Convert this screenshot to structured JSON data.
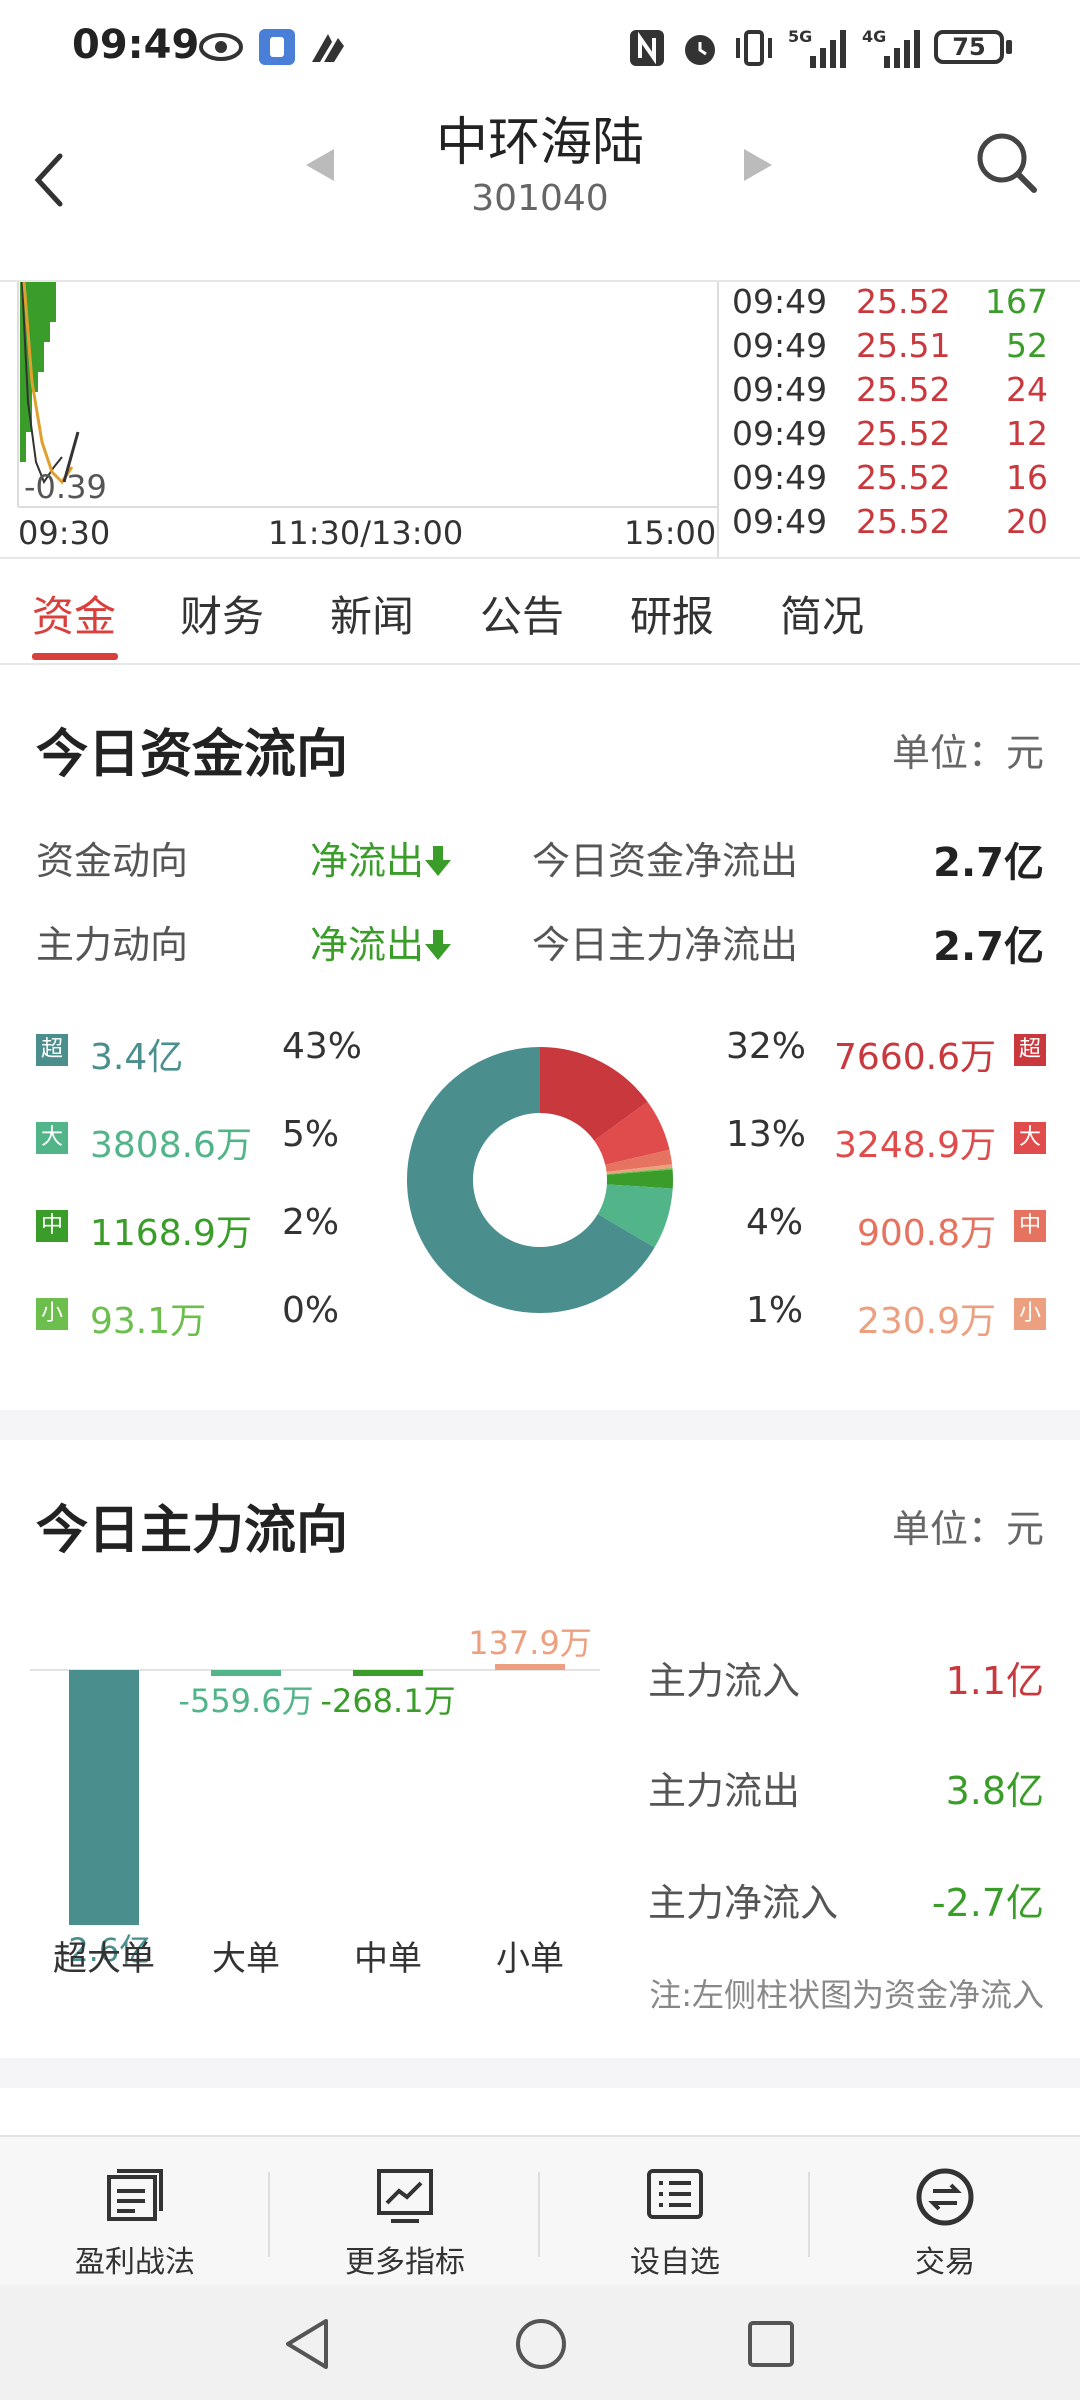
{
  "status_bar": {
    "time": "09:49",
    "battery": "75",
    "icons": [
      "eye-icon",
      "notification-app-icon",
      "app-logo-icon",
      "nfc-icon",
      "alarm-icon",
      "vibrate-icon",
      "signal-5g-icon",
      "signal-4g-icon",
      "battery-icon"
    ]
  },
  "header": {
    "title": "中环海陆",
    "code": "301040"
  },
  "minichart": {
    "low_value": "-0.39",
    "time_labels": [
      "09:30",
      "11:30/13:00",
      "15:00"
    ],
    "trades": [
      {
        "time": "09:49",
        "price": "25.52",
        "vol": "167"
      },
      {
        "time": "09:49",
        "price": "25.51",
        "vol": "52"
      },
      {
        "time": "09:49",
        "price": "25.52",
        "vol": "24"
      },
      {
        "time": "09:49",
        "price": "25.52",
        "vol": "12"
      },
      {
        "time": "09:49",
        "price": "25.52",
        "vol": "16"
      },
      {
        "time": "09:49",
        "price": "25.52",
        "vol": "20"
      }
    ]
  },
  "tabs": [
    {
      "label": "资金",
      "active": true
    },
    {
      "label": "财务"
    },
    {
      "label": "新闻"
    },
    {
      "label": "公告"
    },
    {
      "label": "研报"
    },
    {
      "label": "简况"
    }
  ],
  "fund_flow": {
    "title": "今日资金流向",
    "unit": "单位：元",
    "row1": {
      "label": "资金动向",
      "dir": "净流出",
      "desc": "今日资金净流出",
      "value": "2.7亿"
    },
    "row2": {
      "label": "主力动向",
      "dir": "净流出",
      "desc": "今日主力净流出",
      "value": "2.7亿"
    },
    "outflow": [
      {
        "badge": "超",
        "value": "3.4亿",
        "pct": "43%",
        "color": "#4a8e8e"
      },
      {
        "badge": "大",
        "value": "3808.6万",
        "pct": "5%",
        "color": "#52b58a"
      },
      {
        "badge": "中",
        "value": "1168.9万",
        "pct": "2%",
        "color": "#3a9d2a"
      },
      {
        "badge": "小",
        "value": "93.1万",
        "pct": "0%",
        "color": "#6cbf4c"
      }
    ],
    "inflow": [
      {
        "badge": "超",
        "value": "7660.6万",
        "pct": "32%",
        "color": "#c8383d"
      },
      {
        "badge": "大",
        "value": "3248.9万",
        "pct": "13%",
        "color": "#e04b4b"
      },
      {
        "badge": "中",
        "value": "900.8万",
        "pct": "4%",
        "color": "#e6735f"
      },
      {
        "badge": "小",
        "value": "230.9万",
        "pct": "1%",
        "color": "#eda080"
      }
    ]
  },
  "chart_data": [
    {
      "type": "pie",
      "values": [
        7660.6,
        3248.9,
        900.8,
        230.9,
        93.1,
        1168.9,
        3808.6,
        34000
      ],
      "colors": [
        "#c8383d",
        "#e04b4b",
        "#e6735f",
        "#eda080",
        "#6cbf4c",
        "#3a9d2a",
        "#52b58a",
        "#4a8e8e"
      ]
    },
    {
      "type": "bar",
      "categories": [
        "超大单",
        "大单",
        "中单",
        "小单"
      ],
      "values": [
        -26000,
        -559.6,
        -268.1,
        137.9
      ],
      "value_labels": [
        "-2.6亿",
        "-559.6万",
        "-268.1万",
        "137.9万"
      ],
      "colors": [
        "#4a8e8e",
        "#52b58a",
        "#3a9d2a",
        "#eda080"
      ]
    }
  ],
  "main_flow": {
    "title": "今日主力流向",
    "unit": "单位：元",
    "stats": [
      {
        "label": "主力流入",
        "value": "1.1亿",
        "color": "#c8383d"
      },
      {
        "label": "主力流出",
        "value": "3.8亿",
        "color": "#3a9d2a"
      },
      {
        "label": "主力净流入",
        "value": "-2.7亿",
        "color": "#3a9d2a"
      }
    ],
    "note": "注:左侧柱状图为资金净流入"
  },
  "toolbar": [
    {
      "label": "盈利战法",
      "icon": "strategy-icon"
    },
    {
      "label": "更多指标",
      "icon": "chart-indicator-icon"
    },
    {
      "label": "设自选",
      "icon": "watchlist-icon"
    },
    {
      "label": "交易",
      "icon": "trade-icon"
    }
  ],
  "nav": {
    "icons": [
      "back-triangle-icon",
      "home-circle-icon",
      "recents-square-icon"
    ]
  }
}
